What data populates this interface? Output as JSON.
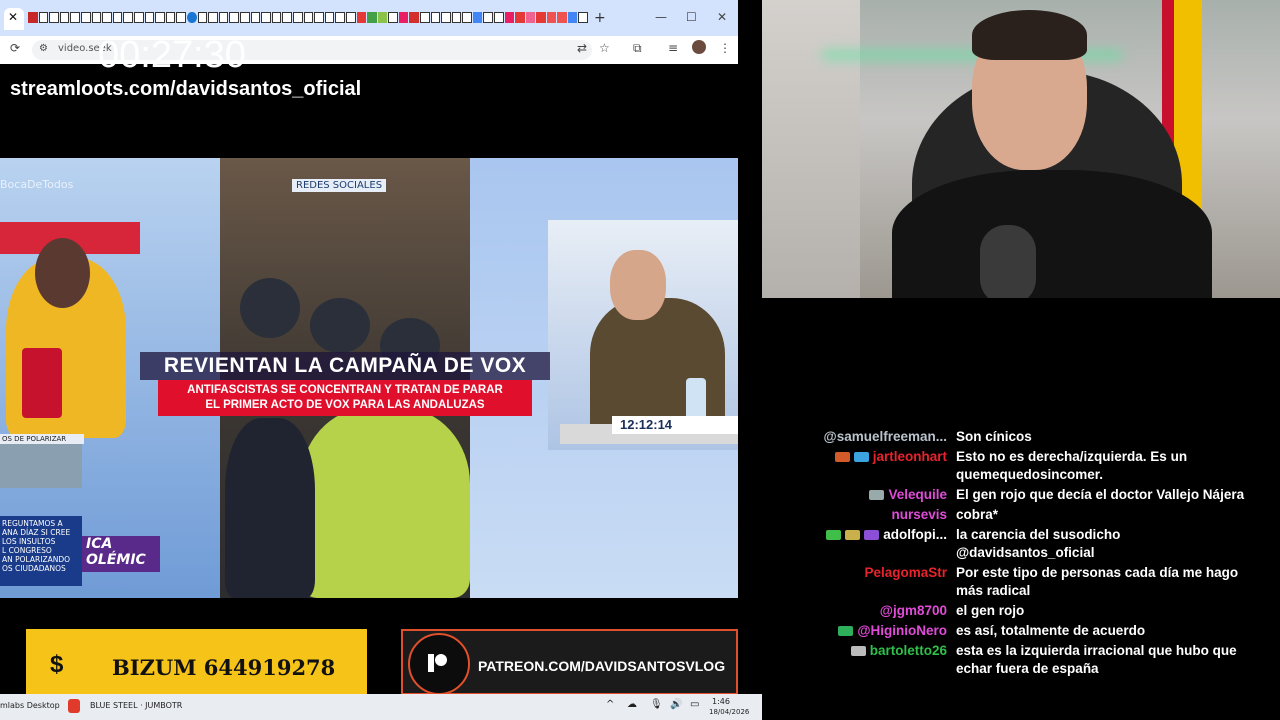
{
  "browser": {
    "tab_close": "✕",
    "new_tab": "+",
    "url": "video.seek",
    "window_minimize": "—",
    "window_maximize": "☐",
    "window_close": "✕"
  },
  "overlay": {
    "timer": "00:27:30",
    "streamloots": "streamloots.com/davidsantos_oficial"
  },
  "video": {
    "hashtag": "BocaDeTodos",
    "redes_label": "REDES SOCIALES",
    "pill_label": "OS DE POLARIZAR",
    "ticker_left": "REGUNTAMOS A\nANA DÍAZ SI CREE\nLOS INSULTOS\nL CONGRESO\nAN POLARIZANDO\nOS CIUDADANOS",
    "ticker_caption": "ICA\nOLÉMIC",
    "headline": "REVIENTAN LA CAMPAÑA DE VOX",
    "subhead_line1": "ANTIFASCISTAS SE CONCENTRAN Y TRATAN DE PARAR",
    "subhead_line2": "EL PRIMER ACTO DE VOX PARA LAS ANDALUZAS",
    "clock": "12:12:14"
  },
  "banners": {
    "bizum_symbol": "$",
    "bizum_text": "BIZUM 644919278",
    "patreon_text": "PATREON.COM/DAVIDSANTOSVLOG"
  },
  "taskbar": {
    "item1": "mlabs Desktop",
    "item2": "BLUE STEEL · JUMBOTR",
    "time": "1:46",
    "date": "18/04/2026"
  },
  "chat": [
    {
      "user": "@samuelfreeman...",
      "color": "#b9c3cc",
      "badges": [],
      "text": "Son cínicos"
    },
    {
      "user": "jartleonhart",
      "color": "#e8232b",
      "badges": [
        "#d35b2a",
        "#3da3e0"
      ],
      "text": "Esto no es derecha/izquierda. Es un quemequedosincomer."
    },
    {
      "user": "Velequile",
      "color": "#e04bd8",
      "badges": [
        "#9aa"
      ],
      "text": "El gen rojo que decía el doctor Vallejo Nájera"
    },
    {
      "user": "nursevis",
      "color": "#e04bd8",
      "badges": [],
      "text": "cobra*"
    },
    {
      "user": "adolfopi...",
      "color": "#ffffff",
      "badges": [
        "#3fbf4a",
        "#c9b04a",
        "#8a4fd6"
      ],
      "text": "la carencia del susodicho @davidsantos_oficial"
    },
    {
      "user": "PelagomaStr",
      "color": "#e8232b",
      "badges": [],
      "text": "Por este tipo de personas cada día me hago más radical"
    },
    {
      "user": "@jgm8700",
      "color": "#e04bd8",
      "badges": [],
      "text": "el gen rojo"
    },
    {
      "user": "@HiginioNero",
      "color": "#e04bd8",
      "badges": [
        "#2fae5c"
      ],
      "text": "es así, totalmente de acuerdo"
    },
    {
      "user": "bartoletto26",
      "color": "#2fbf4a",
      "badges": [
        "#bbb"
      ],
      "text": "esta es la izquierda irracional que hubo que echar fuera de españa"
    }
  ]
}
